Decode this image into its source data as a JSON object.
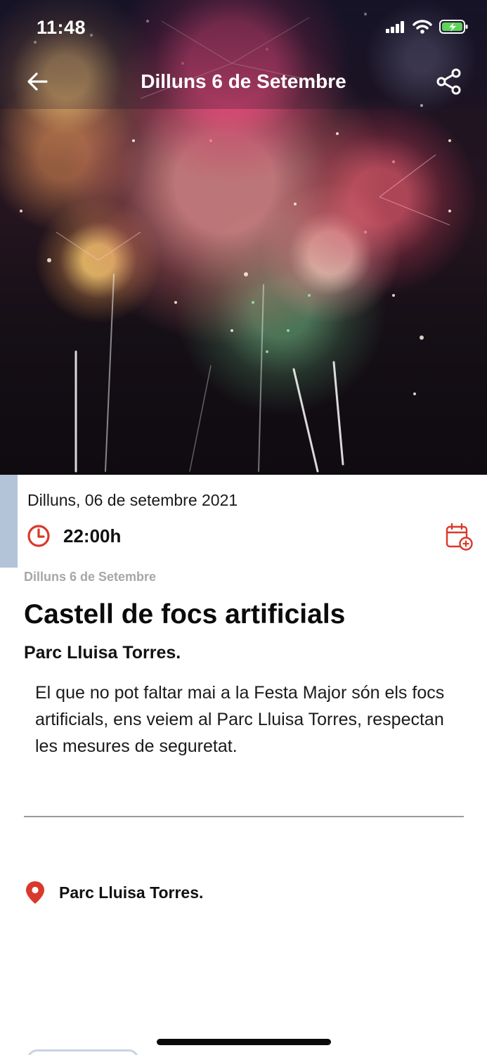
{
  "status_bar": {
    "time": "11:48"
  },
  "nav": {
    "title": "Dilluns 6 de Setembre"
  },
  "event": {
    "date_full": "Dilluns, 06 de setembre 2021",
    "time": "22:00h",
    "day_heading": "Dilluns 6 de Setembre",
    "title": "Castell de focs artificials",
    "venue": "Parc Lluisa Torres.",
    "description": "El que no pot faltar mai a la Festa Major són els focs artificials, ens veiem al Parc Lluisa Torres, respectan les mesures de seguretat.",
    "location": "Parc Lluisa Torres."
  },
  "icons": {
    "back": "arrow-left-icon",
    "share": "share-icon",
    "clock": "clock-icon",
    "calendar_add": "calendar-add-icon",
    "location": "map-pin-icon"
  },
  "colors": {
    "accent_red": "#d9392b",
    "accent_bar": "#b3c3d8",
    "muted_text": "#a7a7a7"
  }
}
